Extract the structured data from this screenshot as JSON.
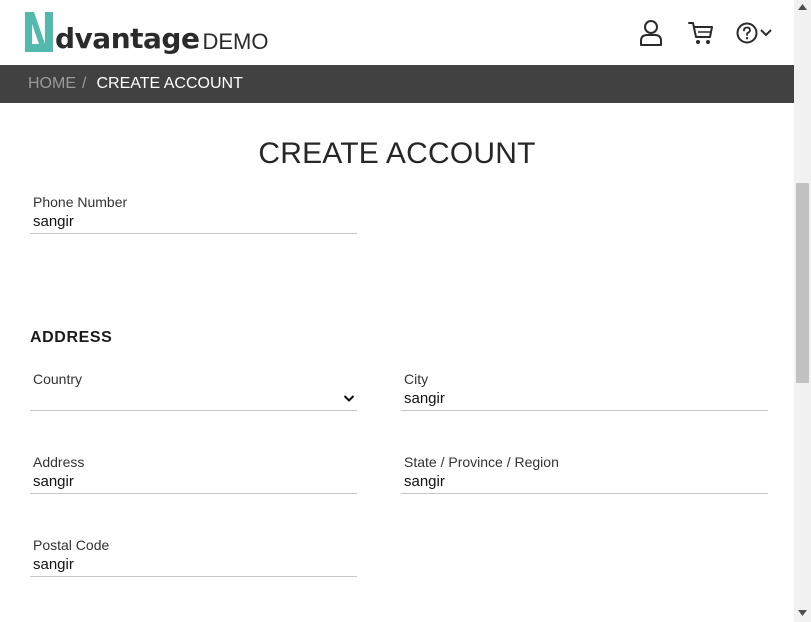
{
  "header": {
    "logo_text": "dvantage",
    "logo_sub": "DEMO",
    "icons": [
      "user-icon",
      "cart-icon",
      "help-icon",
      "chevron-down-icon"
    ]
  },
  "breadcrumb": {
    "home": "HOME",
    "separator": "/",
    "current": "CREATE ACCOUNT"
  },
  "main": {
    "title": "CREATE ACCOUNT",
    "phone": {
      "label": "Phone Number",
      "value": "sangir"
    },
    "address_section": "ADDRESS",
    "country": {
      "label": "Country",
      "value": ""
    },
    "city": {
      "label": "City",
      "value": "sangir"
    },
    "address": {
      "label": "Address",
      "value": "sangir"
    },
    "state": {
      "label": "State / Province / Region",
      "value": "sangir"
    },
    "postal": {
      "label": "Postal Code",
      "value": "sangir"
    }
  },
  "colors": {
    "brand_teal": "#54B8AD",
    "breadcrumb_bg": "#414141",
    "text_dark": "#262626"
  }
}
